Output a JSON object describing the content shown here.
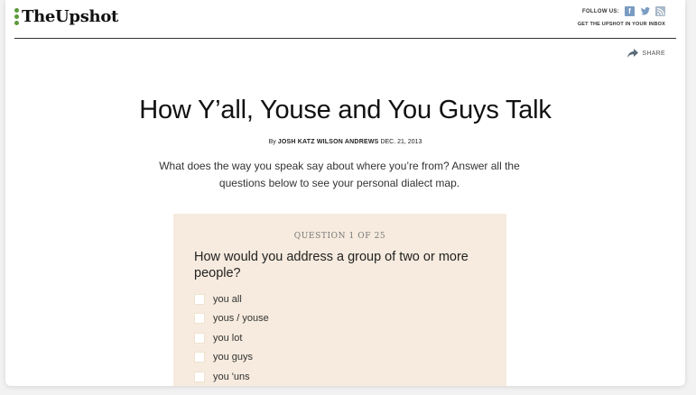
{
  "header": {
    "logo_text": "TheUpshot",
    "follow_label": "FOLLOW US:",
    "social": [
      {
        "name": "facebook-icon",
        "glyph": "f"
      },
      {
        "name": "twitter-icon",
        "glyph": "🐦"
      },
      {
        "name": "rss-icon",
        "glyph": "))"
      }
    ],
    "inbox_link": "GET THE UPSHOT IN YOUR INBOX",
    "share_label": "SHARE"
  },
  "article": {
    "headline": "How Y’all, Youse and You Guys Talk",
    "byline_prefix": "By",
    "authors": "JOSH KATZ WILSON ANDREWS",
    "date": "DEC. 21, 2013",
    "intro": "What does the way you speak say about where you’re from? Answer all the questions below to see your personal dialect map."
  },
  "quiz": {
    "counter": "QUESTION 1 OF 25",
    "question": "How would you address a group of two or more people?",
    "options": [
      "you all",
      "yous / youse",
      "you lot",
      "you guys",
      "you 'uns"
    ]
  },
  "colors": {
    "accent_green": "#5b9a3b",
    "quiz_background": "#f6ebde",
    "social_blue": "#7a9cc2"
  }
}
